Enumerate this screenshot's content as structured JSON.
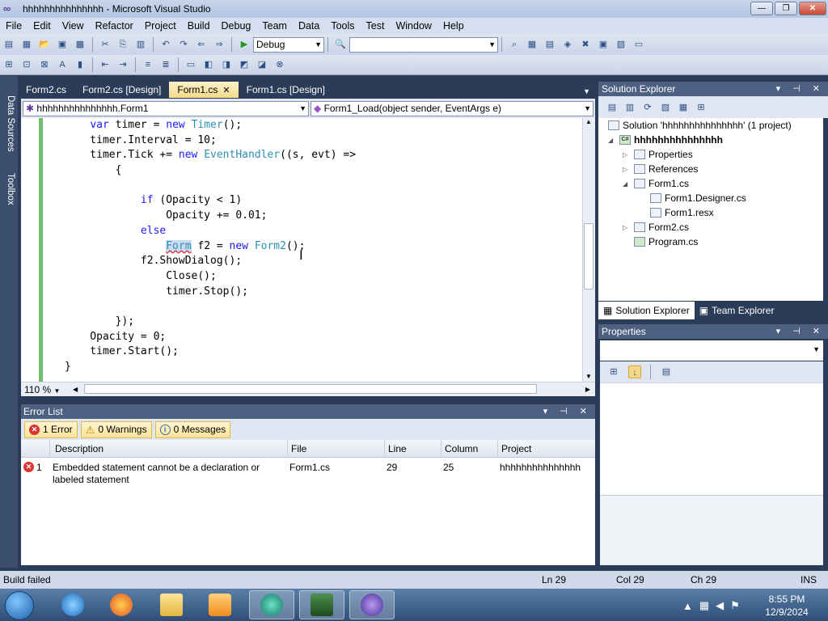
{
  "window": {
    "title": "hhhhhhhhhhhhhhh - Microsoft Visual Studio"
  },
  "menu": [
    "File",
    "Edit",
    "View",
    "Refactor",
    "Project",
    "Build",
    "Debug",
    "Team",
    "Data",
    "Tools",
    "Test",
    "Window",
    "Help"
  ],
  "toolbar": {
    "config_value": "Debug",
    "find_value": ""
  },
  "side_tabs": {
    "data_sources": "Data Sources",
    "toolbox": "Toolbox"
  },
  "doc_tabs": [
    {
      "label": "Form2.cs"
    },
    {
      "label": "Form2.cs [Design]"
    },
    {
      "label": "Form1.cs",
      "close": "✕"
    },
    {
      "label": "Form1.cs [Design]"
    }
  ],
  "nav": {
    "type_combo": "hhhhhhhhhhhhhhh.Form1",
    "member_combo": "Form1_Load(object sender, EventArgs e)"
  },
  "editor": {
    "lines": [
      "    var timer = new Timer();",
      "    timer.Interval = 10;",
      "    timer.Tick += new EventHandler((s, evt) =>",
      "        {",
      "",
      "            if (Opacity < 1)",
      "                Opacity += 0.01;",
      "            else",
      "                Form f2 = new Form2();",
      "            f2.ShowDialog();",
      "                Close();",
      "                timer.Stop();",
      "",
      "        });",
      "    Opacity = 0;",
      "    timer.Start();",
      "}"
    ],
    "zoom": "110 %"
  },
  "error_list": {
    "title": "Error List",
    "filters": {
      "errors": "1 Error",
      "warnings": "0 Warnings",
      "messages": "0 Messages"
    },
    "columns": [
      "Description",
      "File",
      "Line",
      "Column",
      "Project"
    ],
    "rows": [
      {
        "num": "1",
        "description": "Embedded statement cannot be a declaration or labeled statement",
        "file": "Form1.cs",
        "line": "29",
        "column": "25",
        "project": "hhhhhhhhhhhhhhh"
      }
    ]
  },
  "solution_explorer": {
    "title": "Solution Explorer",
    "solution": "Solution 'hhhhhhhhhhhhhhh' (1 project)",
    "project": "hhhhhhhhhhhhhhh",
    "items": [
      "Properties",
      "References",
      "Form1.cs",
      "Form1.Designer.cs",
      "Form1.resx",
      "Form2.cs",
      "Program.cs"
    ],
    "tabs": [
      "Solution Explorer",
      "Team Explorer"
    ]
  },
  "properties": {
    "title": "Properties"
  },
  "status": {
    "message": "Build failed",
    "ln": "Ln 29",
    "col": "Col 29",
    "ch": "Ch 29",
    "mode": "INS"
  },
  "taskbar": {
    "time": "8:55 PM",
    "date": "12/9/2024"
  },
  "colors": {
    "keyword": "#1a1aff",
    "type": "#2b91af",
    "active_tab": "#f5d989",
    "panel_header": "#4d6082"
  }
}
